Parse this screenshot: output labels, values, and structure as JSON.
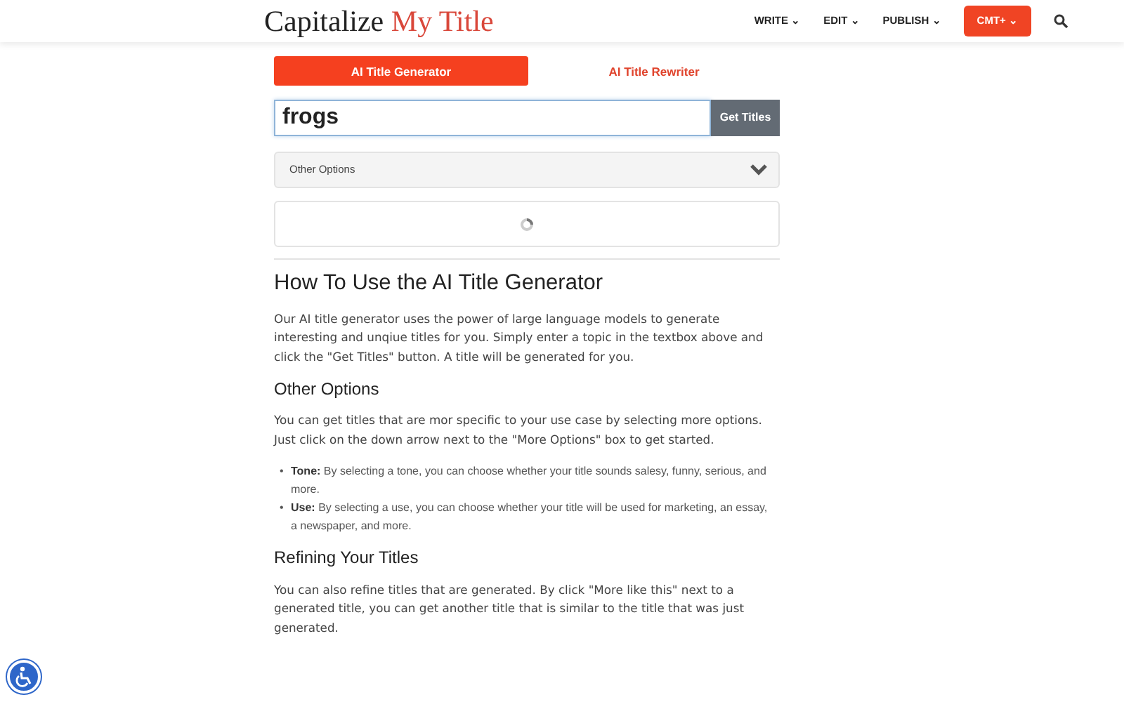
{
  "header": {
    "logo": {
      "text": "Capitalize",
      "accent": "My Title"
    },
    "nav": [
      {
        "kind": "menu",
        "label": "WRITE",
        "caret": "⌄"
      },
      {
        "kind": "menu",
        "label": "EDIT",
        "caret": "⌄"
      },
      {
        "kind": "menu",
        "label": "PUBLISH",
        "caret": "⌄"
      },
      {
        "kind": "button",
        "label": "CMT+",
        "caret": "⌄"
      },
      {
        "kind": "search"
      }
    ]
  },
  "tabs": [
    {
      "label": "AI Title Generator",
      "selected": true
    },
    {
      "label": "AI Title Rewriter",
      "selected": false
    }
  ],
  "topic_field": {
    "value": "frogs",
    "button": "Get Titles"
  },
  "options_panel": {
    "label": "Other Options",
    "expanded": false
  },
  "results": {
    "loading": true
  },
  "article": [
    {
      "kind": "h2",
      "text": "How To Use the AI Title Generator"
    },
    {
      "kind": "p",
      "text": "Our AI title generator uses the power of large language models to generate interesting and unqiue titles for you. Simply enter a topic in the textbox above and click the \"Get Titles\" button. A title will be generated for you."
    },
    {
      "kind": "h3",
      "text": "Other Options"
    },
    {
      "kind": "p",
      "text": "You can get titles that are mor specific to your use case by selecting more options. Just click on the down arrow next to the \"More Options\" box to get started."
    },
    {
      "kind": "ul",
      "items": [
        {
          "marker": "•",
          "text": "**Tone:** By selecting a tone, you can choose whether your title sounds salesy, funny, serious, and more."
        },
        {
          "marker": "•",
          "text": "**Use:** By selecting a use, you can choose whether your title will be used for marketing, an essay, a newspaper, and more."
        }
      ]
    },
    {
      "kind": "h3",
      "text": "Refining Your Titles"
    },
    {
      "kind": "p",
      "text": "You can also refine titles that are generated. By click \"More like this\" next to a generated title, you can get another title that is similar to the title that was just generated."
    }
  ]
}
